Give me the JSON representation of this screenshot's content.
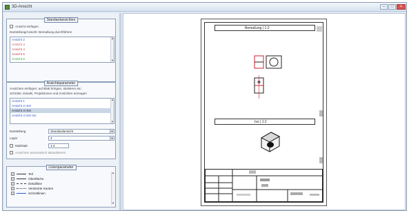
{
  "window": {
    "title": "3D-Ansicht"
  },
  "left_panel": {
    "group1": {
      "title": "Standardansichten",
      "checkbox_label": "Ansicht einfügen",
      "hint": "Darstellung/Ansicht: Bemaßung durchführen",
      "items": [
        "Ansicht 2",
        "Ansicht 3",
        "Ansicht 4",
        "Ansicht 5",
        "Ansicht 6"
      ],
      "item_colors": [
        "#3355cc",
        "#cc5566",
        "#cc4444",
        "#cc3355",
        "#33aa44"
      ]
    },
    "group2": {
      "title": "Ansichtsparameter",
      "hint1": "Ansichten einfügen: auf Blatt bringen, skalieren etc.",
      "hint2": "Schnitte, Details, Projektionen und Ansichten erzeugen",
      "items": [
        "Ansicht 1",
        "Ansicht 2 ISO",
        "Ansicht 3 ISO",
        "Ansicht 4 ISO Iso"
      ],
      "selected_index": 2,
      "field1_label": "Darstellung",
      "field1_value": "Standardansicht",
      "field2_label": "Layer",
      "field2_value": "4",
      "check_scale_label": "Maßstab",
      "scale_value": "1:4",
      "check_update_label": "Ansichten automatisch aktualisieren"
    },
    "group3": {
      "title": "Linienparameter",
      "rows": [
        "Teil",
        "Oberfläche",
        "Detaillinie",
        "Verdeckte Kanten",
        "Schnittlinien"
      ]
    }
  },
  "drawing": {
    "view1_title": "Bemaßung | 1:2",
    "view2_title": "Iso | 1:2",
    "accent": "#cc2233"
  }
}
